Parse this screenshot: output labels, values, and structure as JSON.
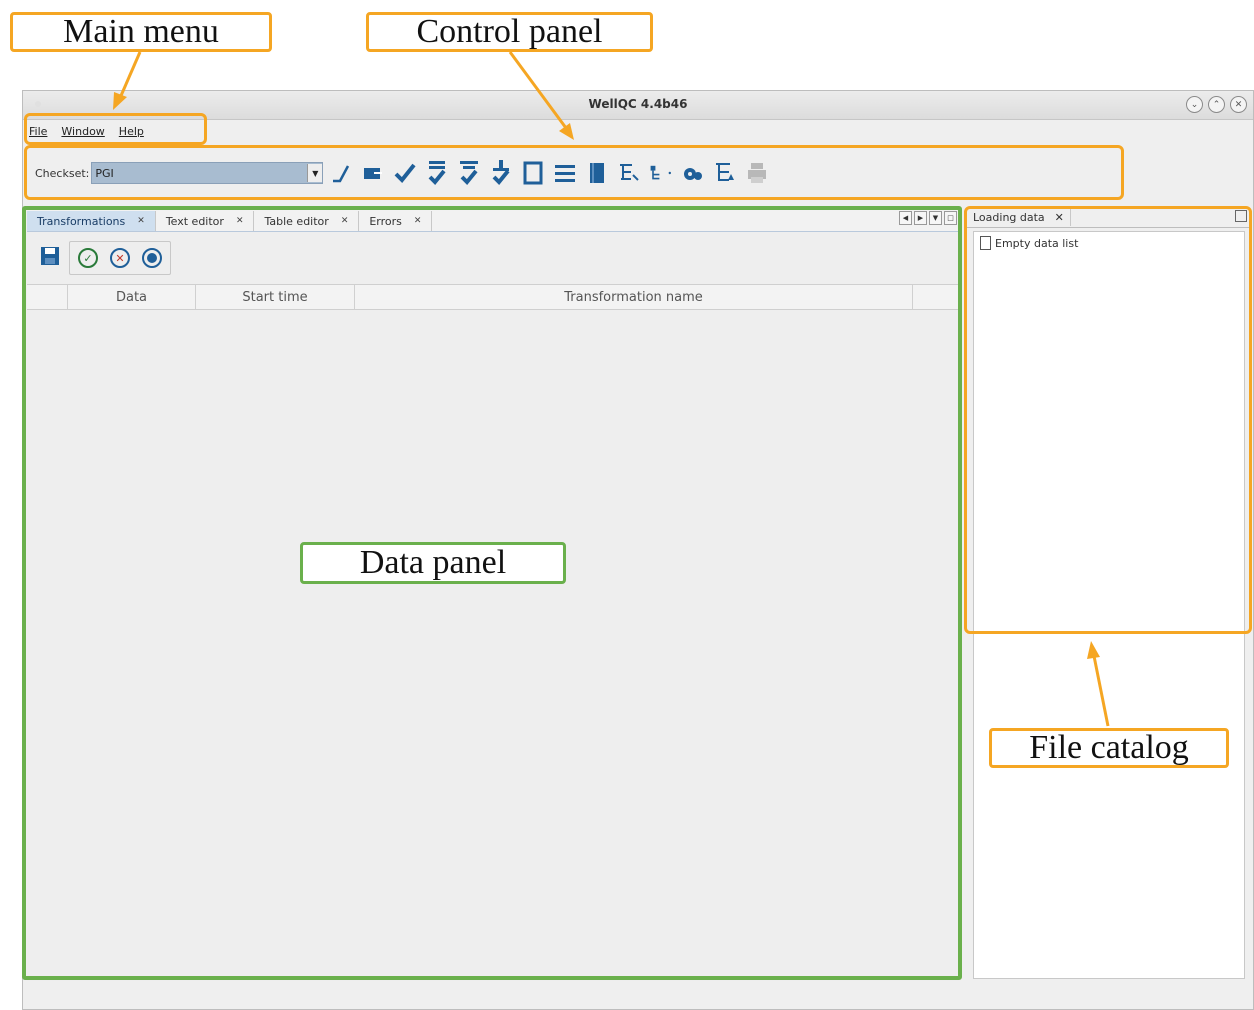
{
  "annotations": {
    "main_menu": "Main menu",
    "control_panel": "Control panel",
    "data_panel": "Data panel",
    "file_catalog": "File catalog"
  },
  "window": {
    "title": "WellQC 4.4b46",
    "buttons": [
      "⌄",
      "⌃",
      "✕"
    ]
  },
  "menu": [
    "File",
    "Window",
    "Help"
  ],
  "toolbar": {
    "checkset_label": "Checkset:",
    "checkset_value": "PGI",
    "icons": [
      "edit-curve-icon",
      "export-icon",
      "check-icon",
      "check-list-icon",
      "check-filter-icon",
      "check-down-icon",
      "frame-icon",
      "settings-lines-icon",
      "book-icon",
      "tree-select-icon",
      "tree-icon",
      "gears-icon",
      "tree-arrow-icon",
      "printer-icon"
    ]
  },
  "data_panel": {
    "tabs": [
      {
        "label": "Transformations",
        "active": true
      },
      {
        "label": "Text editor",
        "active": false
      },
      {
        "label": "Table editor",
        "active": false
      },
      {
        "label": "Errors",
        "active": false
      }
    ],
    "columns": [
      "Data",
      "Start time",
      "Transformation name"
    ]
  },
  "catalog": {
    "tab": "Loading data",
    "empty": "Empty data list"
  },
  "colors": {
    "annotation": "#f5a623",
    "data_panel_annotation": "#6ab04c",
    "icon": "#1f5f99"
  }
}
